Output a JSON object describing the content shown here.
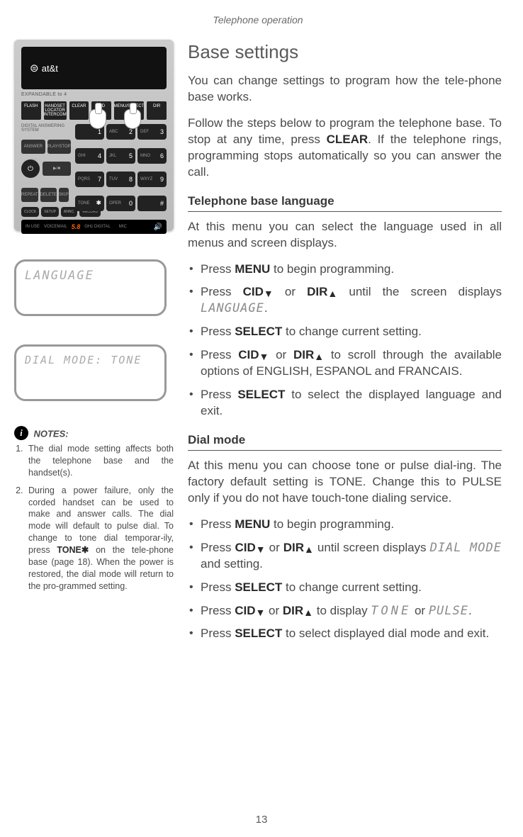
{
  "header": "Telephone operation",
  "title": "Base settings",
  "intro1": "You can change settings to program how the tele-phone base works.",
  "intro2_a": "Follow the steps below to program the telephone base. To stop at any time, press ",
  "intro2_kw": "CLEAR",
  "intro2_b": ". If the telephone rings, programming stops automatically so you can answer the call.",
  "sec1_title": "Telephone base language",
  "sec1_intro": "At this menu you can select the language used in all menus and screen displays.",
  "b1_a": "Press ",
  "b1_kw": "MENU",
  "b1_b": " to begin programming.",
  "b2_a": "Press ",
  "b2_kw1": "CID",
  "b2_mid": " or ",
  "b2_kw2": "DIR",
  "b2_b": " until the screen displays ",
  "b2_seg": "LANGUAGE",
  "b2_c": ".",
  "b3_a": "Press ",
  "b3_kw": "SELECT",
  "b3_b": " to change current setting.",
  "b4_a": "Press ",
  "b4_kw1": "CID",
  "b4_mid": " or ",
  "b4_kw2": "DIR",
  "b4_b": " to scroll through the available options of ENGLISH, ESPANOL and FRANCAIS.",
  "b5_a": "Press ",
  "b5_kw": "SELECT",
  "b5_b": " to select the displayed language and exit.",
  "sec2_title": "Dial mode",
  "sec2_intro": "At this menu you can choose tone or pulse dial-ing. The factory default setting is TONE. Change this to PULSE only if you do not have touch-tone dialing service.",
  "c1_a": "Press ",
  "c1_kw": "MENU",
  "c1_b": " to begin programming.",
  "c2_a": "Press ",
  "c2_kw1": "CID",
  "c2_mid": " or ",
  "c2_kw2": "DIR",
  "c2_b": " until screen displays ",
  "c2_seg": "DIAL MODE",
  "c2_c": " and setting.",
  "c3_a": "Press ",
  "c3_kw": "SELECT",
  "c3_b": " to change current setting.",
  "c4_a": "Press ",
  "c4_kw1": "CID",
  "c4_mid": " or ",
  "c4_kw2": "DIR",
  "c4_b": " to display ",
  "c4_seg1": "TONE",
  "c4_or": " or ",
  "c4_seg2": "PULSE",
  "c4_c": ".",
  "c5_a": "Press ",
  "c5_kw": "SELECT",
  "c5_b": " to select displayed dial mode and exit.",
  "lcd1": "LANGUAGE",
  "lcd2": "DIAL MODE: TONE",
  "notes_title": "NOTES:",
  "note1": "The dial mode setting affects both the telephone base and the handset(s).",
  "note2_a": "During a power failure, only the corded handset can be used to make and answer calls. The dial mode will default to pulse dial. To change to tone dial temporar-ily, press ",
  "note2_kw": "TONE✱",
  "note2_b": " on the tele-phone base (page 18). When the power is restored, the dial mode will return to the pro-grammed setting.",
  "page_num": "13",
  "phone": {
    "att": "at&t",
    "expand": "EXPANDABLE to 4",
    "row1": [
      "FLASH",
      "HANDSET LOCATOR INTERCOM",
      "CLEAR",
      "CID",
      "MENU/SELECT",
      "DIR"
    ],
    "ans_on": "ANSWER ON",
    "play": "PLAY/STOP",
    "repeat": "REPEAT",
    "delete": "DELETE",
    "skip": "SKIP",
    "clock": "CLOCK",
    "setup": "SETUP",
    "annc": "ANNC.",
    "record": "RECORD",
    "inuse": "IN USE",
    "vmail": "VOICEMAIL",
    "brand": "5.8",
    "dig": "GHz DIGITAL",
    "mic": "MIC",
    "das": "DIGITAL ANSWERING SYSTEM",
    "keys": [
      {
        "s": "",
        "n": "1"
      },
      {
        "s": "ABC",
        "n": "2"
      },
      {
        "s": "DEF",
        "n": "3"
      },
      {
        "s": "GHI",
        "n": "4"
      },
      {
        "s": "JKL",
        "n": "5"
      },
      {
        "s": "MNO",
        "n": "6"
      },
      {
        "s": "PQRS",
        "n": "7"
      },
      {
        "s": "TUV",
        "n": "8"
      },
      {
        "s": "WXYZ",
        "n": "9"
      },
      {
        "s": "TONE",
        "n": "✱"
      },
      {
        "s": "OPER",
        "n": "0"
      },
      {
        "s": "",
        "n": "#"
      }
    ]
  }
}
